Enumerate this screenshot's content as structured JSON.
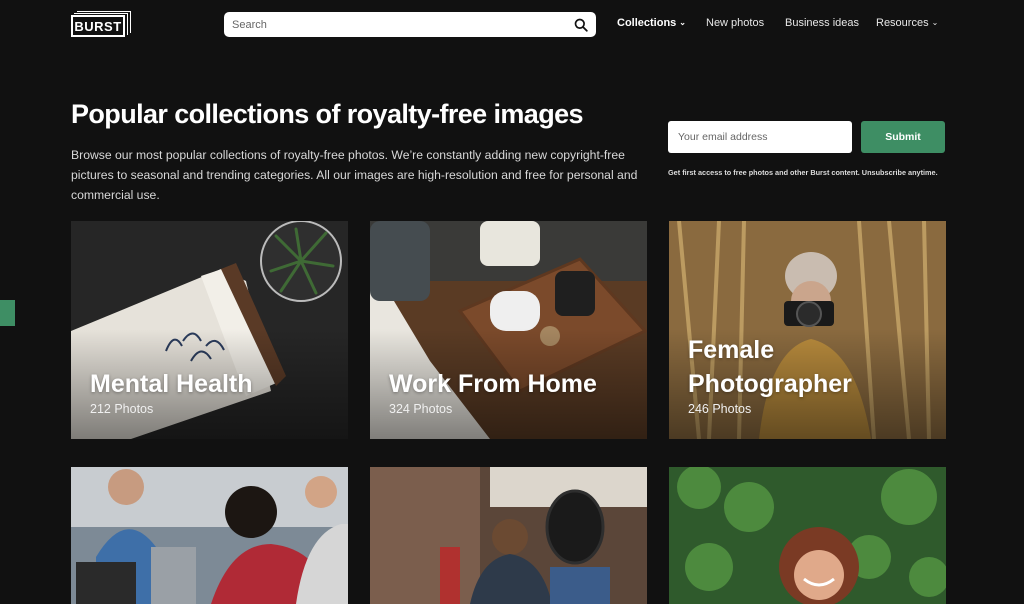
{
  "header": {
    "logo_text": "BURST",
    "search_placeholder": "Search",
    "nav": [
      {
        "label": "Collections",
        "dropdown": true
      },
      {
        "label": "New photos",
        "dropdown": false
      },
      {
        "label": "Business ideas",
        "dropdown": false
      },
      {
        "label": "Resources",
        "dropdown": true
      }
    ],
    "chevron": "⌄"
  },
  "hero": {
    "title": "Popular collections of royalty-free images",
    "description": "Browse our most popular collections of royalty-free photos. We’re constantly adding new copyright-free pictures to seasonal and trending categories. All our images are high-resolution and free for personal and commercial use."
  },
  "newsletter": {
    "email_placeholder": "Your email address",
    "submit_label": "Submit",
    "note": "Get first access to free photos and other Burst content. Unsubscribe anytime."
  },
  "collections": [
    {
      "title_lines": [
        "Mental Health"
      ],
      "count": "212 Photos"
    },
    {
      "title_lines": [
        "Work From Home"
      ],
      "count": "324 Photos"
    },
    {
      "title_lines": [
        "Female",
        "Photographer"
      ],
      "count": "246 Photos"
    },
    {
      "title_lines": [],
      "count": ""
    },
    {
      "title_lines": [],
      "count": ""
    },
    {
      "title_lines": [],
      "count": ""
    }
  ],
  "colors": {
    "background": "#111111",
    "accent_green": "#3e8e64"
  },
  "icons": [
    "search-icon",
    "chevron-down-icon"
  ]
}
